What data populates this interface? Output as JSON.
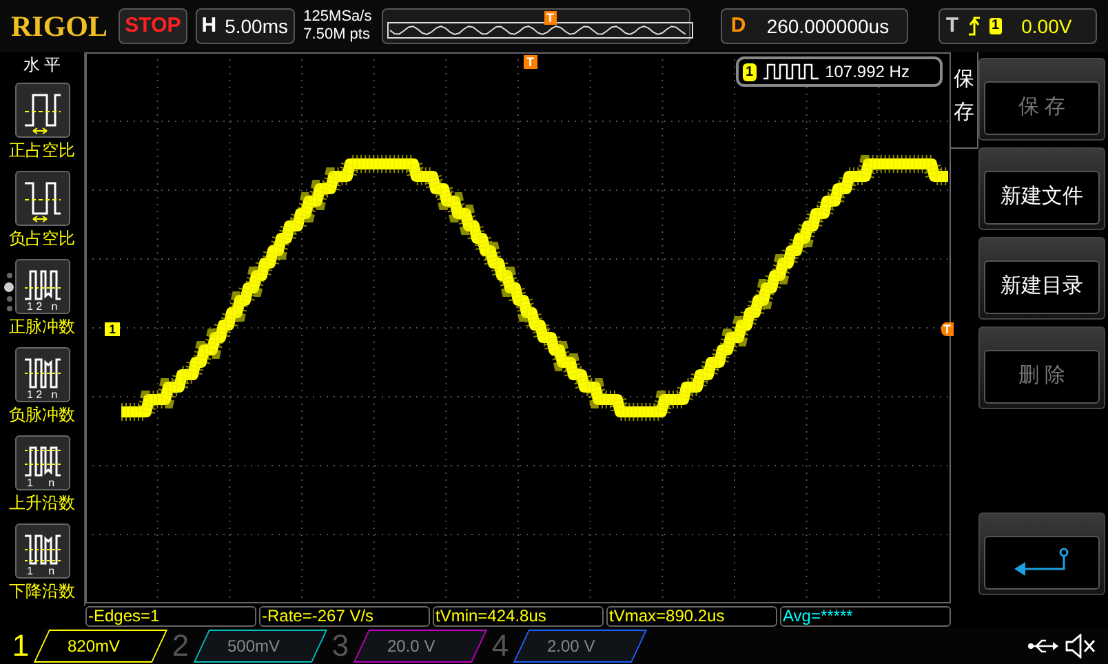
{
  "top_bar": {
    "logo": "RIGOL",
    "run_state": "STOP",
    "horizontal": {
      "label": "H",
      "value": "5.00ms"
    },
    "sample_rate": "125MSa/s",
    "memory_depth": "7.50M pts",
    "overview_marker": "T",
    "delay": {
      "label": "D",
      "value": "260.000000us"
    },
    "trigger": {
      "label": "T",
      "source": "1",
      "level": "0.00V"
    }
  },
  "left_menu": {
    "title": "水 平",
    "page_dots": [
      {
        "selected": false
      },
      {
        "selected": true
      },
      {
        "selected": false
      },
      {
        "selected": false
      }
    ],
    "items": [
      {
        "kind": "pos_duty",
        "label": "正占空比"
      },
      {
        "kind": "neg_duty",
        "label": "负占空比"
      },
      {
        "kind": "pos_pulses",
        "label": "正脉冲数",
        "index_labels": "1 2   n"
      },
      {
        "kind": "neg_pulses",
        "label": "负脉冲数",
        "index_labels": "1 2   n"
      },
      {
        "kind": "rise_edges",
        "label": "上升沿数",
        "index_labels": "1     n"
      },
      {
        "kind": "fall_edges",
        "label": "下降沿数",
        "index_labels": "1     n"
      }
    ]
  },
  "display": {
    "channel_marker": "1",
    "trigger_marker_top": "T",
    "trigger_marker_right": "T",
    "frequency": {
      "channel": "1",
      "value": "107.992 Hz"
    }
  },
  "right_menu": {
    "title": "保存",
    "items": [
      {
        "kind": "text",
        "label": "保 存",
        "disabled": true
      },
      {
        "kind": "text",
        "label": "新建文件",
        "disabled": false
      },
      {
        "kind": "text",
        "label": "新建目录",
        "disabled": false
      },
      {
        "kind": "text",
        "label": "删 除",
        "disabled": true
      },
      {
        "kind": "back"
      }
    ]
  },
  "measurements": [
    {
      "text": "-Edges=1",
      "color": "#ffff00"
    },
    {
      "text": "-Rate=-267 V/s",
      "color": "#ffff00"
    },
    {
      "text": "tVmin=424.8us",
      "color": "#ffff00"
    },
    {
      "text": "tVmax=890.2us",
      "color": "#ffff00"
    },
    {
      "text": "Avg=*****",
      "color": "#00ffff"
    }
  ],
  "channels": [
    {
      "number": "1",
      "scale": "820mV",
      "on": true,
      "color": "#ffff00"
    },
    {
      "number": "2",
      "scale": "500mV",
      "on": false,
      "color": "#00c0c0"
    },
    {
      "number": "3",
      "scale": "20.0 V",
      "on": false,
      "color": "#c000c0"
    },
    {
      "number": "4",
      "scale": "2.00 V",
      "on": false,
      "color": "#2060ff"
    }
  ]
}
